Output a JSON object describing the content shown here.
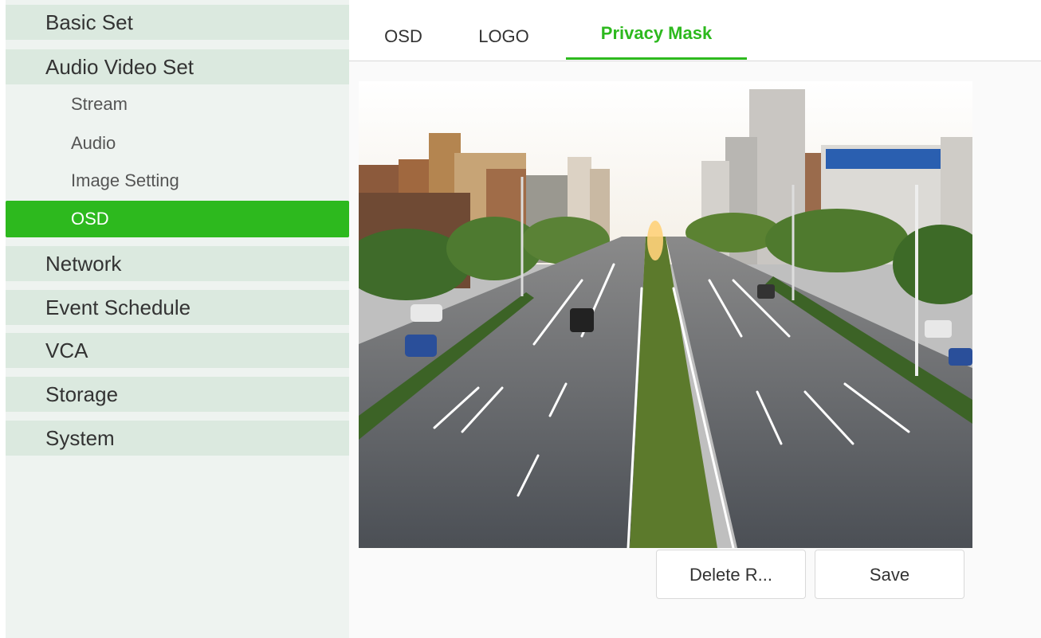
{
  "sidebar": {
    "items": [
      {
        "label": "Basic Set"
      },
      {
        "label": "Audio Video Set"
      },
      {
        "label": "Network"
      },
      {
        "label": "Event Schedule"
      },
      {
        "label": "VCA"
      },
      {
        "label": "Storage"
      },
      {
        "label": "System"
      }
    ],
    "subitems": [
      {
        "label": "Stream"
      },
      {
        "label": "Audio"
      },
      {
        "label": "Image Setting"
      },
      {
        "label": "OSD",
        "active": true
      }
    ]
  },
  "tabs": [
    {
      "label": "OSD"
    },
    {
      "label": "LOGO"
    },
    {
      "label": "Privacy Mask",
      "active": true
    }
  ],
  "preview": {
    "content": "live-camera-view"
  },
  "buttons": {
    "delete_label": "Delete R...",
    "save_label": "Save"
  },
  "colors": {
    "accent": "#2db91e",
    "sidebar_bg": "#eef3f0",
    "nav_item_bg": "#dbe9df"
  }
}
